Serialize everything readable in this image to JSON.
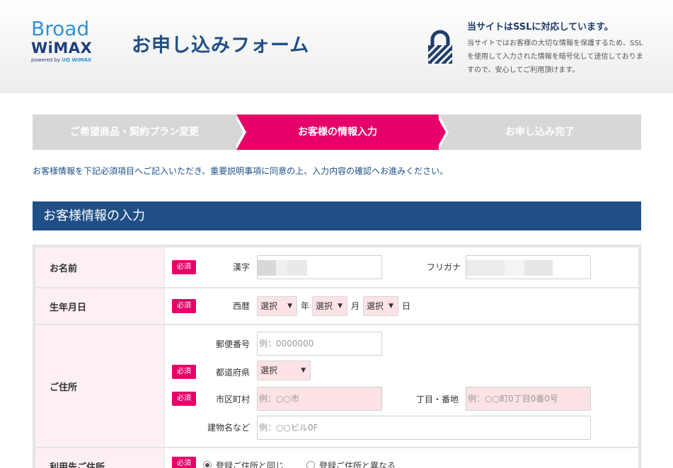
{
  "header": {
    "logo_broad": "Broad",
    "logo_wimax": "WiMAX",
    "logo_powered": "powered by",
    "logo_powered_brand": "UQ WiMAX",
    "title": "お申し込みフォーム",
    "ssl_title": "当サイトはSSLに対応しています。",
    "ssl_desc": "当サイトではお客様の大切な情報を保護するため、SSLを使用して入力された情報を暗号化して送信しておりますので、安心してご利用頂けます。"
  },
  "steps": [
    {
      "label": "ご希望商品・契約プラン変更"
    },
    {
      "label": "お客様の情報入力"
    },
    {
      "label": "お申し込み完了"
    }
  ],
  "intro": "お客様情報を下記必須項目へご記入いただき、重要説明事項に同意の上、入力内容の確認へお進みください。",
  "section_title": "お客様情報の入力",
  "required_label": "必須",
  "form": {
    "name": {
      "head": "お名前",
      "kanji_label": "漢字",
      "kana_label": "フリガナ"
    },
    "birth": {
      "head": "生年月日",
      "era_label": "西暦",
      "year_select": "選択",
      "year_unit": "年",
      "month_select": "選択",
      "month_unit": "月",
      "day_select": "選択",
      "day_unit": "日"
    },
    "address": {
      "head": "ご住所",
      "postal_label": "郵便番号",
      "postal_placeholder": "例：0000000",
      "pref_label": "都道府県",
      "pref_select": "選択",
      "city_label": "市区町村",
      "city_placeholder": "例：○○市",
      "block_label": "丁目・番地",
      "block_placeholder": "例：○○町0丁目0番0号",
      "building_label": "建物名など",
      "building_placeholder": "例：○○ビル0F"
    },
    "use_address": {
      "head": "利用先ご住所",
      "option_same": "登録ご住所と同じ",
      "option_diff": "登録ご住所と異なる"
    }
  },
  "colors": {
    "brand_blue": "#1f4f86",
    "accent_pink": "#e8006a",
    "step_inactive": "#d7d7d7",
    "required_field_bg": "#fde3e6"
  }
}
